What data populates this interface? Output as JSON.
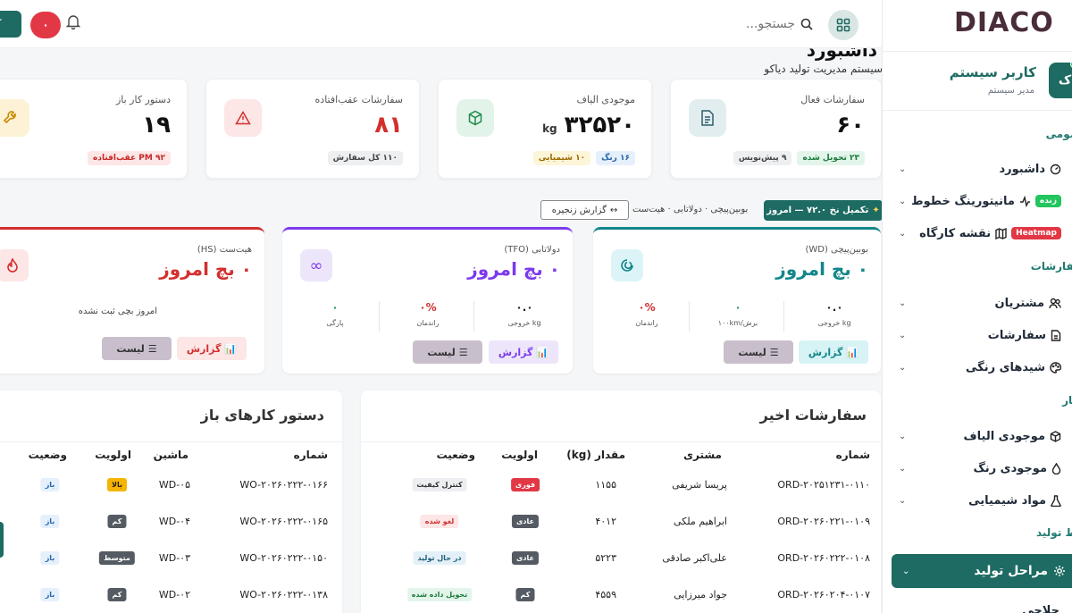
{
  "app": {
    "logo": "DIACO"
  },
  "topbar": {
    "search_placeholder": "جستجو...",
    "notif_count": "۰",
    "corner_label": "ک"
  },
  "page": {
    "title": "داشبورد",
    "subtitle": "سیستم مدیریت تولید دیاکو"
  },
  "user": {
    "name": "کاربر سیستم",
    "role": "مدیر سیستم",
    "avatar": "ک"
  },
  "sidebar": {
    "sections": [
      "عمومی",
      "سفارشات",
      "انبار",
      "خط تولید"
    ],
    "items": [
      {
        "label": "داشبورد"
      },
      {
        "label": "مانیتورینگ خطوط",
        "badge": "زنده"
      },
      {
        "label": "نقشه کارگاه",
        "badge": "Heatmap"
      },
      {
        "label": "مشتریان"
      },
      {
        "label": "سفارشات"
      },
      {
        "label": "شیدهای رنگی"
      },
      {
        "label": "موجودی الیاف"
      },
      {
        "label": "موجودی رنگ"
      },
      {
        "label": "مواد شیمیایی"
      },
      {
        "label": "مراحل تولید"
      },
      {
        "label": "حلاجی"
      }
    ]
  },
  "stats": [
    {
      "label": "سفارشات فعال",
      "value": "۶۰",
      "chips": [
        "۲۳ تحویل شده",
        "۹ پیش‌نویس"
      ]
    },
    {
      "label": "موجودی الیاف",
      "value": "۳۲۵۲۰",
      "unit": "kg",
      "chips": [
        "۱۶ رنگ",
        "۱۰ شیمیایی"
      ]
    },
    {
      "label": "سفارشات عقب‌افتاده",
      "value": "۸۱",
      "chips": [
        "۱۱۰ کل سفارش"
      ]
    },
    {
      "label": "دستور کار باز",
      "value": "۱۹",
      "chips": [
        "۹۲ PM عقب‌افتاده"
      ]
    }
  ],
  "info_bar": {
    "pill": "تکمیل نخ ۷۲.۰ — امروز",
    "text": "بوبین‌پیچی · دولاتابی · هیت‌ست",
    "chain_btn": "گزارش زنجیره"
  },
  "machines": [
    {
      "title": "بوبین‌پیچی (WD)",
      "big": "۰ بچ امروز",
      "color": "#13868a",
      "metrics": [
        {
          "v": "۰.۰",
          "l": "kg خروجی"
        },
        {
          "v": "۰",
          "l": "برش/۱۰۰km"
        },
        {
          "v": "۰%",
          "l": "راندمان"
        }
      ],
      "report": "گزارش",
      "list": "لیست"
    },
    {
      "title": "دولاتابی (TFO)",
      "big": "۰ بچ امروز",
      "color": "#7c3aed",
      "metrics": [
        {
          "v": "۰.۰",
          "l": "kg خروجی"
        },
        {
          "v": "۰%",
          "l": "راندمان"
        },
        {
          "v": "۰",
          "l": "پارگی"
        }
      ],
      "report": "گزارش",
      "list": "لیست"
    },
    {
      "title": "هیت‌ست (HS)",
      "big": "۰ بچ امروز",
      "color": "#d32f2f",
      "empty": "امروز بچی ثبت نشده",
      "report": "گزارش",
      "list": "لیست"
    }
  ],
  "orders": {
    "title": "سفارشات اخیر",
    "columns": [
      "شماره",
      "مشتری",
      "مقدار (kg)",
      "اولویت",
      "وضعیت"
    ],
    "rows": [
      {
        "id": "ORD-۲۰۲۵۱۲۳۱-۰۱۱۰",
        "customer": "پریسا شریفی",
        "qty": "۱۱۵۵",
        "priority": "فوری",
        "status": "کنترل کیفیت"
      },
      {
        "id": "ORD-۲۰۲۶۰۲۲۱-۰۱۰۹",
        "customer": "ابراهیم ملکی",
        "qty": "۴۰۱۲",
        "priority": "عادی",
        "status": "لغو شده"
      },
      {
        "id": "ORD-۲۰۲۶۰۲۲۲-۰۱۰۸",
        "customer": "علی‌اکبر صادقی",
        "qty": "۵۲۲۳",
        "priority": "عادی",
        "status": "در حال تولید"
      },
      {
        "id": "ORD-۲۰۲۶۰۲۰۴-۰۱۰۷",
        "customer": "جواد میرزایی",
        "qty": "۴۵۵۹",
        "priority": "کم",
        "status": "تحویل داده شده"
      }
    ]
  },
  "workorders": {
    "title": "دستور کارهای باز",
    "columns": [
      "شماره",
      "ماشین",
      "اولویت",
      "وضعیت"
    ],
    "rows": [
      {
        "id": "WO-۲۰۲۶۰۲۲۲-۰۱۶۶",
        "machine": "WD-۰۵",
        "priority": "بالا",
        "status": "باز"
      },
      {
        "id": "WO-۲۰۲۶۰۲۲۲-۰۱۶۵",
        "machine": "WD-۰۴",
        "priority": "کم",
        "status": "باز"
      },
      {
        "id": "WO-۲۰۲۶۰۲۲۲-۰۱۵۰",
        "machine": "WD-۰۳",
        "priority": "متوسط",
        "status": "باز"
      },
      {
        "id": "WO-۲۰۲۶۰۲۲۲-۰۱۳۸",
        "machine": "WD-۰۲",
        "priority": "کم",
        "status": "باز"
      }
    ]
  }
}
